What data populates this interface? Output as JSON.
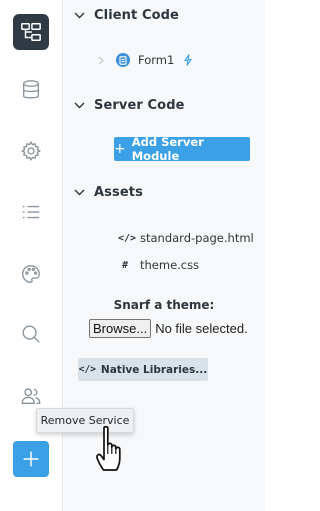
{
  "rail": {
    "items": [
      {
        "icon": "app-structure-icon",
        "active": true
      },
      {
        "icon": "database-icon",
        "active": false
      },
      {
        "icon": "settings-gear-icon",
        "active": false
      },
      {
        "icon": "list-icon",
        "active": false
      },
      {
        "icon": "palette-icon",
        "active": false
      },
      {
        "icon": "search-icon",
        "active": false
      },
      {
        "icon": "users-icon",
        "active": false
      },
      {
        "icon": "plus-icon",
        "active": false
      }
    ],
    "accent": "#3ba0e6"
  },
  "client_code": {
    "title": "Client Code",
    "forms": [
      {
        "label": "Form1",
        "icon": "form-icon",
        "startup_icon": "lightning-icon"
      }
    ]
  },
  "server_code": {
    "title": "Server Code",
    "add_button_label": "Add Server Module"
  },
  "assets": {
    "title": "Assets",
    "items": [
      {
        "icon_text": "</>",
        "label": "standard-page.html"
      },
      {
        "icon_text": "#",
        "label": "theme.css"
      }
    ]
  },
  "snarf": {
    "title": "Snarf a theme:",
    "browse_label": "Browse...",
    "file_status": "No file selected."
  },
  "native_libraries": {
    "icon_text": "</>",
    "label": "Native Libraries..."
  },
  "tooltip": {
    "text": "Remove Service"
  }
}
